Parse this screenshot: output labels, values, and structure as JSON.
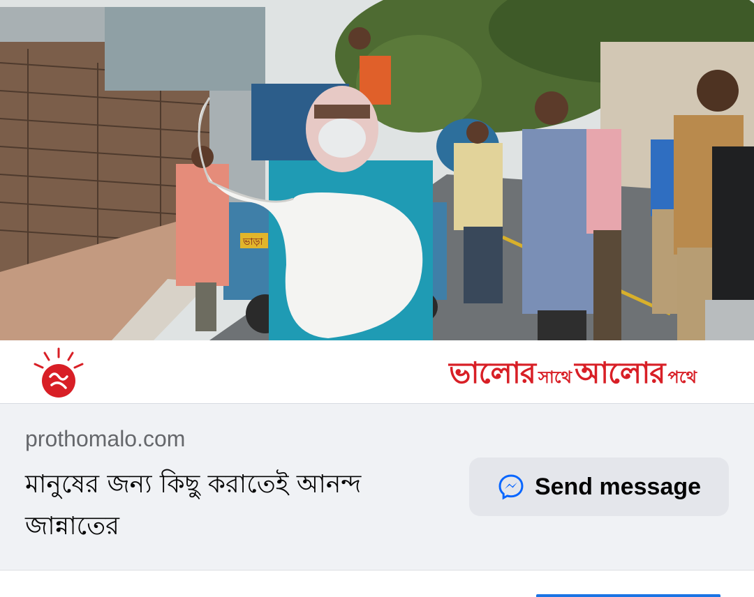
{
  "post_image": {
    "alt": "",
    "truck_plate_text": "ভাড়া"
  },
  "banner": {
    "logo": "prothom-alo-sun-logo",
    "slogan": {
      "part1": "ভালোর",
      "part2": "সাথে",
      "part3": "আলোর",
      "part4": "পথে"
    }
  },
  "link_card": {
    "domain": "prothomalo.com",
    "headline": "মানুষের জন্য কিছু করাতেই আনন্দ জান্নাতের",
    "button": {
      "label": "Send message",
      "icon": "messenger-icon"
    }
  },
  "colors": {
    "brand_red": "#d81f26",
    "card_bg": "#f0f2f5",
    "button_bg": "#e4e6eb",
    "messenger_blue": "#0866ff"
  }
}
